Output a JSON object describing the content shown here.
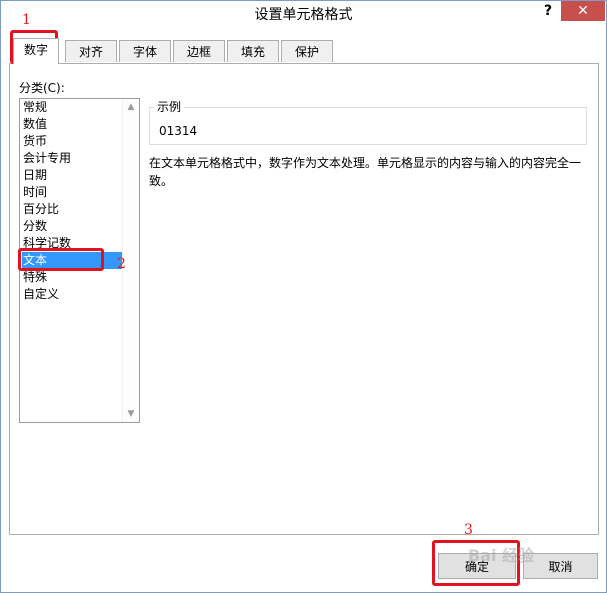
{
  "dialog": {
    "title": "设置单元格格式",
    "help": "?",
    "close": "✕"
  },
  "tabs": [
    {
      "label": "数字"
    },
    {
      "label": "对齐"
    },
    {
      "label": "字体"
    },
    {
      "label": "边框"
    },
    {
      "label": "填充"
    },
    {
      "label": "保护"
    }
  ],
  "category": {
    "label": "分类(C):",
    "items": [
      "常规",
      "数值",
      "货币",
      "会计专用",
      "日期",
      "时间",
      "百分比",
      "分数",
      "科学记数",
      "文本",
      "特殊",
      "自定义"
    ],
    "selected": "文本"
  },
  "sample": {
    "legend": "示例",
    "value": "01314"
  },
  "description": "在文本单元格格式中，数字作为文本处理。单元格显示的内容与输入的内容完全一致。",
  "buttons": {
    "ok": "确定",
    "cancel": "取消"
  },
  "annotations": {
    "step1": "1",
    "step2": "2",
    "step3": "3"
  },
  "watermark": "Bai 经验",
  "colors": {
    "highlight": "#e0141e",
    "selection": "#3399ff",
    "close": "#c7504d"
  }
}
